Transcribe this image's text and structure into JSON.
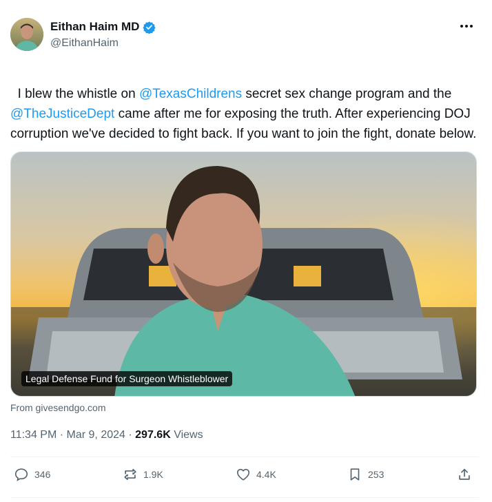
{
  "author": {
    "display_name": "Eithan Haim MD",
    "handle": "@EithanHaim",
    "verified": true
  },
  "tweet": {
    "segments": [
      {
        "type": "text",
        "text": "I blew the whistle on "
      },
      {
        "type": "mention",
        "text": "@TexasChildrens"
      },
      {
        "type": "text",
        "text": " secret sex change program and the\n"
      },
      {
        "type": "mention",
        "text": "@TheJusticeDept"
      },
      {
        "type": "text",
        "text": " came after me for exposing the truth. After experiencing DOJ corruption we've decided to fight back. If you want to join the fight, donate below."
      }
    ]
  },
  "media": {
    "caption": "Legal Defense Fund for Surgeon Whistleblower",
    "source": "From givesendgo.com"
  },
  "meta": {
    "time": "11:34 PM",
    "date": "Mar 9, 2024",
    "separator": "·",
    "views_count": "297.6K",
    "views_label": "Views"
  },
  "actions": {
    "replies": "346",
    "reposts": "1.9K",
    "likes": "4.4K",
    "bookmarks": "253"
  },
  "colors": {
    "accent": "#1d9bf0",
    "text": "#0f1419",
    "secondary": "#536471"
  }
}
